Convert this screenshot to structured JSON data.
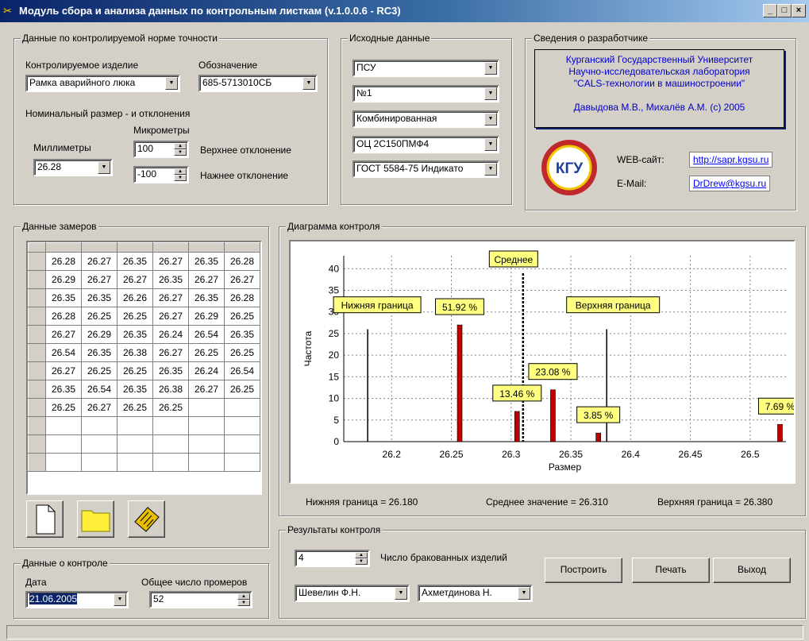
{
  "window": {
    "title": "Модуль сбора и анализа данных по контрольным листкам (v.1.0.0.6 - RC3)",
    "btn_min": "_",
    "btn_max": "□",
    "btn_close": "×"
  },
  "tolerance": {
    "group": "Данные по контролируемой норме точности",
    "product_label": "Контролируемое изделие",
    "product_value": "Рамка аварийного люка",
    "code_label": "Обозначение",
    "code_value": "685-5713010СБ",
    "nominal_label": "Номинальный размер - и отклонения",
    "micrometers_label": "Микрометры",
    "millimeters_label": "Миллиметры",
    "mm_value": "26.28",
    "upper_value": "100",
    "upper_label": "Верхнее отклонение",
    "lower_value": "-100",
    "lower_label": "Нажнее отклонение"
  },
  "source": {
    "group": "Исходные данные",
    "options": [
      "ПСУ",
      "№1",
      "Комбинированная",
      "ОЦ 2С150ПМФ4",
      "ГОСТ 5584-75 Индикато"
    ]
  },
  "developer": {
    "group": "Сведения о разработчике",
    "lines": [
      "Курганский Государственный Университет",
      "Научно-исследовательская лаборатория",
      "\"CALS-технологии в машиностроении\"",
      "",
      "Давыдова М.В., Михалёв А.М. (c) 2005"
    ],
    "web_label": "WEB-сайт:",
    "web_value": "http://sapr.kgsu.ru",
    "email_label": "E-Mail:",
    "email_value": "DrDrew@kgsu.ru",
    "logo_text": "КГУ"
  },
  "measurements": {
    "group": "Данные замеров",
    "rows": [
      [
        "26.28",
        "26.27",
        "26.35",
        "26.27",
        "26.35",
        "26.28"
      ],
      [
        "26.29",
        "26.27",
        "26.27",
        "26.35",
        "26.27",
        "26.27"
      ],
      [
        "26.35",
        "26.35",
        "26.26",
        "26.27",
        "26.35",
        "26.28"
      ],
      [
        "26.28",
        "26.25",
        "26.25",
        "26.27",
        "26.29",
        "26.25"
      ],
      [
        "26.27",
        "26.29",
        "26.35",
        "26.24",
        "26.54",
        "26.35"
      ],
      [
        "26.54",
        "26.35",
        "26.38",
        "26.27",
        "26.25",
        "26.25"
      ],
      [
        "26.27",
        "26.25",
        "26.25",
        "26.35",
        "26.24",
        "26.54"
      ],
      [
        "26.35",
        "26.54",
        "26.35",
        "26.38",
        "26.27",
        "26.25"
      ],
      [
        "26.25",
        "26.27",
        "26.25",
        "26.25",
        "",
        ""
      ],
      [
        "",
        "",
        "",
        "",
        "",
        ""
      ],
      [
        "",
        "",
        "",
        "",
        "",
        ""
      ],
      [
        "",
        "",
        "",
        "",
        "",
        ""
      ]
    ]
  },
  "control": {
    "group": "Данные о контроле",
    "date_label": "Дата",
    "date_value": "21.06.2005",
    "total_label": "Общее число промеров",
    "total_value": "52"
  },
  "chart_section": {
    "group": "Диаграмма контроля",
    "lower_text": "Нижняя граница = 26.180",
    "mean_text": "Среднее значение = 26.310",
    "upper_text": "Верхняя граница = 26.380"
  },
  "chart_data": {
    "type": "bar",
    "xlabel": "Размер",
    "ylabel": "Частота",
    "xlim": [
      26.16,
      26.53
    ],
    "ylim": [
      0,
      43
    ],
    "x_ticks": [
      "26.2",
      "26.25",
      "26.3",
      "26.35",
      "26.4",
      "26.45",
      "26.5"
    ],
    "y_ticks": [
      "0",
      "5",
      "10",
      "15",
      "20",
      "25",
      "30",
      "35",
      "40"
    ],
    "grid": true,
    "bars": [
      {
        "x": 26.257,
        "y": 27,
        "label": "51.92 %"
      },
      {
        "x": 26.305,
        "y": 7,
        "label": "13.46 %"
      },
      {
        "x": 26.335,
        "y": 12,
        "label": "23.08 %"
      },
      {
        "x": 26.373,
        "y": 2,
        "label": "3.85 %"
      },
      {
        "x": 26.525,
        "y": 4,
        "label": "7.69 %"
      }
    ],
    "lower_limit": {
      "x": 26.18,
      "label": "Нижняя граница"
    },
    "mean": {
      "x": 26.31,
      "label": "Среднее"
    },
    "upper_limit": {
      "x": 26.38,
      "label": "Верхняя граница"
    }
  },
  "results": {
    "group": "Результаты контроля",
    "rejects_value": "4",
    "rejects_label": "Число бракованных изделий",
    "build_btn": "Построить",
    "print_btn": "Печать",
    "exit_btn": "Выход",
    "inspector1": "Шевелин Ф.Н.",
    "inspector2": "Ахметдинова Н."
  }
}
